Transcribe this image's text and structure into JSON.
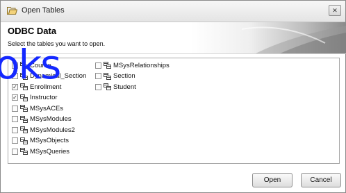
{
  "window": {
    "title": "Open Tables",
    "close_label": "✕"
  },
  "header": {
    "heading": "ODBC Data",
    "subtitle": "Select the tables you want to open."
  },
  "watermark": {
    "text": "oks"
  },
  "tables": [
    {
      "label": "Course",
      "checked": false
    },
    {
      "label": "Dynamical_Section",
      "checked": false
    },
    {
      "label": "Enrollment",
      "checked": true
    },
    {
      "label": "Instructor",
      "checked": true
    },
    {
      "label": "MSysACEs",
      "checked": false
    },
    {
      "label": "MSysModules",
      "checked": false
    },
    {
      "label": "MSysModules2",
      "checked": false
    },
    {
      "label": "MSysObjects",
      "checked": false
    },
    {
      "label": "MSysQueries",
      "checked": false
    },
    {
      "label": "MSysRelationships",
      "checked": false
    },
    {
      "label": "Section",
      "checked": false
    },
    {
      "label": "Student",
      "checked": false
    }
  ],
  "buttons": {
    "open": "Open",
    "cancel": "Cancel"
  },
  "colors": {
    "watermark": "#1428ff"
  }
}
